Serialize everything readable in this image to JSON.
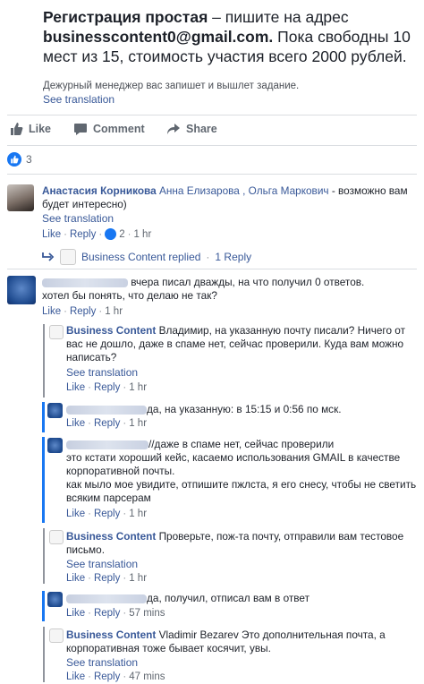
{
  "post": {
    "text_bold_1": "Регистрация простая",
    "text_1": " – пишите на адрес ",
    "text_bold_2": "businesscontent0@gmail.com.",
    "text_2": " Пока свободны 10 мест из 15, стоимость участия всего 2000 рублей.",
    "note": "Дежурный менеджер вас запишет и вышлет задание.",
    "see_translation": "See translation"
  },
  "actions": {
    "like": "Like",
    "comment": "Comment",
    "share": "Share"
  },
  "reactions": {
    "count": "3"
  },
  "common": {
    "like": "Like",
    "reply": "Reply",
    "see_translation": "See translation"
  },
  "comments": [
    {
      "author": "Анастасия Корникова",
      "tags": "Анна Елизарова , Ольга Маркович",
      "text": " - возможно вам будет интересно)",
      "reactions": "2",
      "time": "1 hr",
      "replies_author": "Business Content replied",
      "replies_count": "1 Reply"
    },
    {
      "text_l1": "вчера писал дважды, на что получил 0 ответов.",
      "text_l2": "хотел бы понять, что делаю не так?",
      "time": "1 hr"
    },
    {
      "author": "Business Content",
      "text": " Владимир, на указанную почту писали? Ничего от вас не дошло, даже в спаме нет, сейчас проверили. Куда вам можно написать?",
      "time": "1 hr"
    },
    {
      "text": "да, на указанную: в 15:15 и 0:56 по мск.",
      "time": "1 hr"
    },
    {
      "text_l1": "//даже в спаме нет, сейчас проверили",
      "text_rest": "это кстати хороший кейс, касаемо использования GMAIL в качестве корпоративной почты.\nкак мыло мое увидите, отпишите пжлста, я его снесу, чтобы не светить всяким парсерам",
      "time": "1 hr"
    },
    {
      "author": "Business Content",
      "text": " Проверьте, пож-та почту, отправили вам тестовое письмо.",
      "time": "1 hr"
    },
    {
      "text": "да, получил, отписал вам в ответ",
      "time": "57 mins"
    },
    {
      "author": "Business Content",
      "text": " Vladimir Bezarev Это дополнительная почта, а корпоративная тоже бывает косячит, увы.",
      "time": "47 mins"
    }
  ],
  "colors": {
    "link": "#385898",
    "accent": "#1877f2",
    "muted": "#606770"
  }
}
